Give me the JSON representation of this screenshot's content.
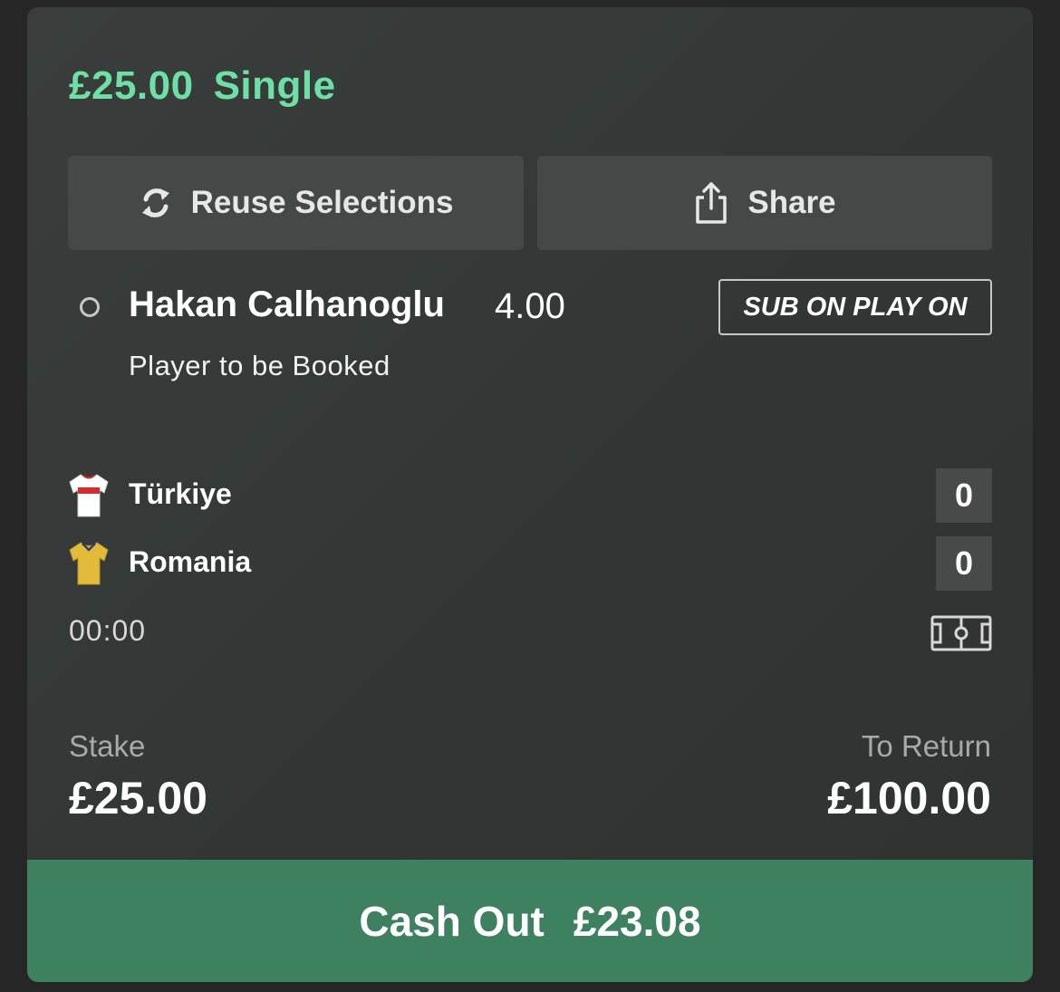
{
  "bet": {
    "stake_amount": "£25.00",
    "bet_type": "Single"
  },
  "actions": {
    "reuse_label": "Reuse Selections",
    "share_label": "Share"
  },
  "selection": {
    "name": "Hakan Calhanoglu",
    "odds": "4.00",
    "market": "Player to be Booked",
    "promo_badge": "SUB ON PLAY ON"
  },
  "match": {
    "home": {
      "name": "Türkiye",
      "score": "0",
      "shirt": "white-red-shirt-icon"
    },
    "away": {
      "name": "Romania",
      "score": "0",
      "shirt": "yellow-shirt-icon"
    },
    "clock": "00:00"
  },
  "summary": {
    "stake_label": "Stake",
    "stake_value": "£25.00",
    "return_label": "To Return",
    "return_value": "£100.00"
  },
  "cashout": {
    "label": "Cash Out",
    "amount": "£23.08"
  },
  "colors": {
    "accent_green": "#6ee0a6",
    "cashout_green": "#3d8160",
    "card_bg": "#353a38"
  }
}
